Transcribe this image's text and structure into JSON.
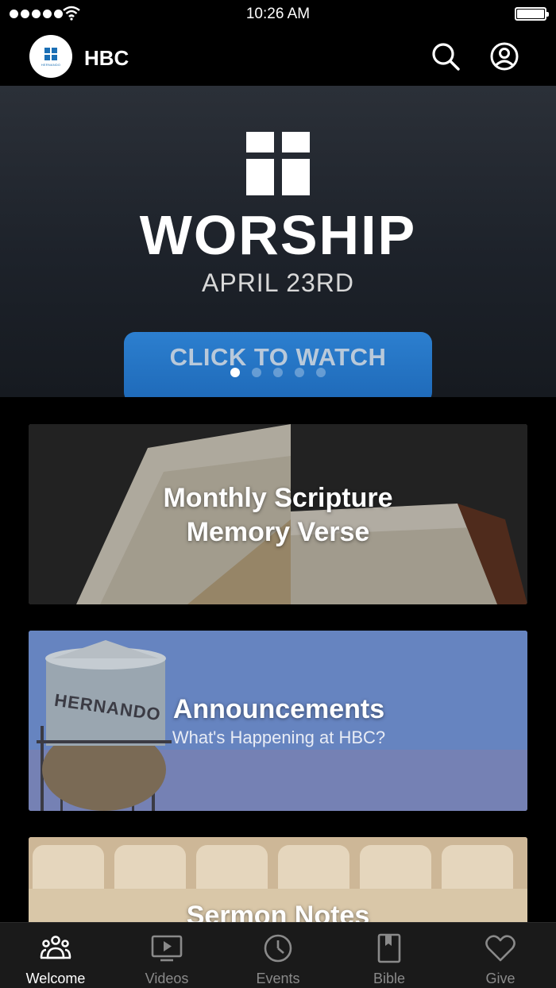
{
  "status_bar": {
    "time": "10:26 AM"
  },
  "header": {
    "logo_text": "HERNANDO",
    "title": "HBC",
    "icons": [
      "search-icon",
      "profile-icon"
    ]
  },
  "hero": {
    "title": "WORSHIP",
    "date": "APRIL 23RD",
    "button_label": "CLICK TO WATCH",
    "carousel_total": 5,
    "carousel_active": 1
  },
  "cards": [
    {
      "title_line1": "Monthly Scripture",
      "title_line2": "Memory Verse"
    },
    {
      "title": "Announcements",
      "subtitle": "What's Happening at HBC?",
      "tower_text": "HERNANDO"
    },
    {
      "title": "Sermon Notes"
    }
  ],
  "tabs": [
    {
      "label": "Welcome",
      "icon": "people-icon",
      "active": true
    },
    {
      "label": "Videos",
      "icon": "tv-icon",
      "active": false
    },
    {
      "label": "Events",
      "icon": "clock-icon",
      "active": false
    },
    {
      "label": "Bible",
      "icon": "book-icon",
      "active": false
    },
    {
      "label": "Give",
      "icon": "heart-icon",
      "active": false
    }
  ],
  "colors": {
    "accent_blue": "#1e69b8",
    "tab_active": "#ffffff",
    "tab_inactive": "#8a8a8a"
  }
}
